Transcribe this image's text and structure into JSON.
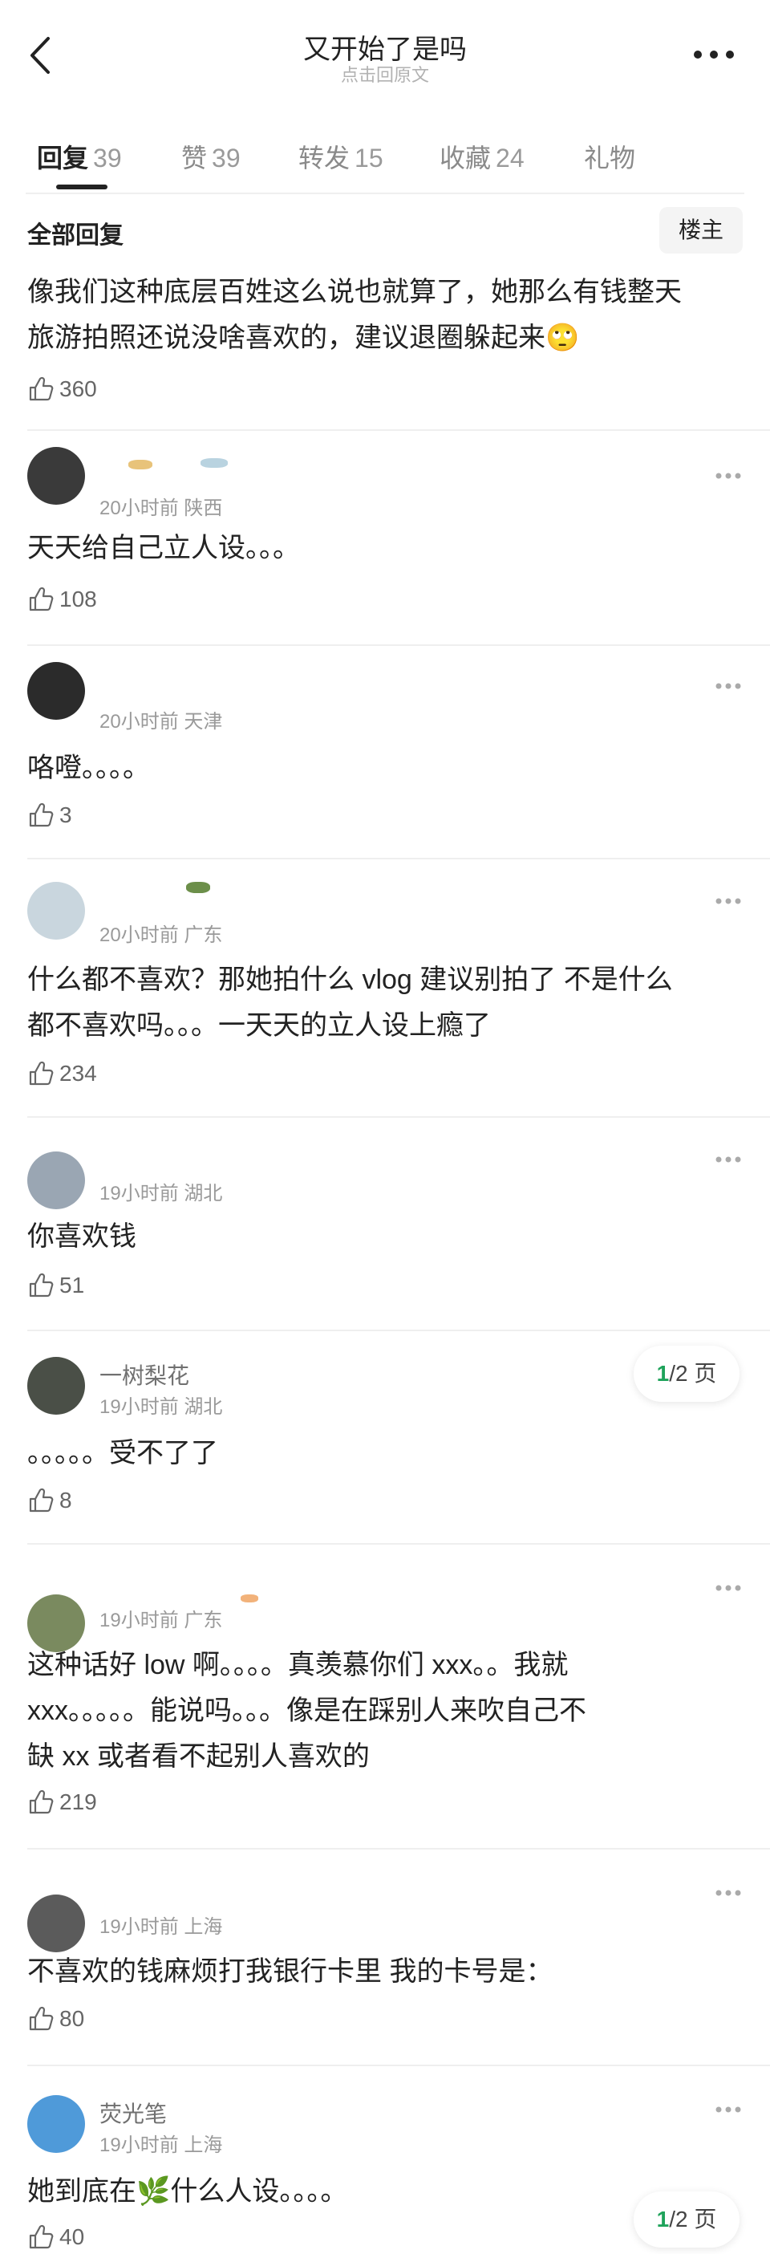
{
  "header": {
    "title": "又开始了是吗",
    "subtitle": "点击回原文"
  },
  "tabs": [
    {
      "label": "回复",
      "count": "39",
      "active": true
    },
    {
      "label": "赞",
      "count": "39",
      "active": false
    },
    {
      "label": "转发",
      "count": "15",
      "active": false
    },
    {
      "label": "收藏",
      "count": "24",
      "active": false
    },
    {
      "label": "礼物",
      "count": "",
      "active": false
    }
  ],
  "section": {
    "title": "全部回复",
    "op_label": "楼主"
  },
  "main_post": {
    "text_line1": "像我们这种底层百姓这么说也就算了，她那么有钱整天",
    "text_line2": "旅游拍照还说没啥喜欢的，建议退圈躲起来🙄",
    "likes": "360"
  },
  "comments": [
    {
      "username": "",
      "meta": "20小时前 陕西",
      "lines": [
        "天天给自己立人设。。。"
      ],
      "likes": "108"
    },
    {
      "username": "",
      "meta": "20小时前 天津",
      "lines": [
        "咯噔。。。。"
      ],
      "likes": "3"
    },
    {
      "username": "",
      "meta": "20小时前 广东",
      "lines": [
        "什么都不喜欢？那她拍什么 vlog 建议别拍了 不是什么",
        "都不喜欢吗。。。一天天的立人设上瘾了"
      ],
      "likes": "234"
    },
    {
      "username": "",
      "meta": "19小时前 湖北",
      "lines": [
        "你喜欢钱"
      ],
      "likes": "51"
    },
    {
      "username": "一树梨花",
      "meta": "19小时前 湖北",
      "lines": [
        "。。。。。受不了了"
      ],
      "likes": "8",
      "page_current": "1",
      "page_total": "/2 页"
    },
    {
      "username": "",
      "meta": "19小时前 广东",
      "lines": [
        "这种话好 low 啊。。。。真羡慕你们 xxx。。我就",
        "xxx。。。。。能说吗。。。像是在踩别人来吹自己不",
        "缺 xx 或者看不起别人喜欢的"
      ],
      "likes": "219"
    },
    {
      "username": "",
      "meta": "19小时前 上海",
      "lines": [
        "不喜欢的钱麻烦打我银行卡里 我的卡号是："
      ],
      "likes": "80"
    },
    {
      "username": "荧光笔",
      "meta": "19小时前 上海",
      "lines": [
        "她到底在🌿什么人设。。。。"
      ],
      "likes": "40",
      "page_current": "1",
      "page_total": "/2 页"
    }
  ],
  "colors": {
    "accent_green": "#1fa35b",
    "text_primary": "#222222",
    "text_secondary": "#9a9a9a",
    "divider": "#efefef"
  },
  "icons": {
    "back": "chevron-left-icon",
    "more": "more-dots-icon",
    "like": "thumbs-up-icon",
    "comment_menu": "ellipsis-icon"
  }
}
